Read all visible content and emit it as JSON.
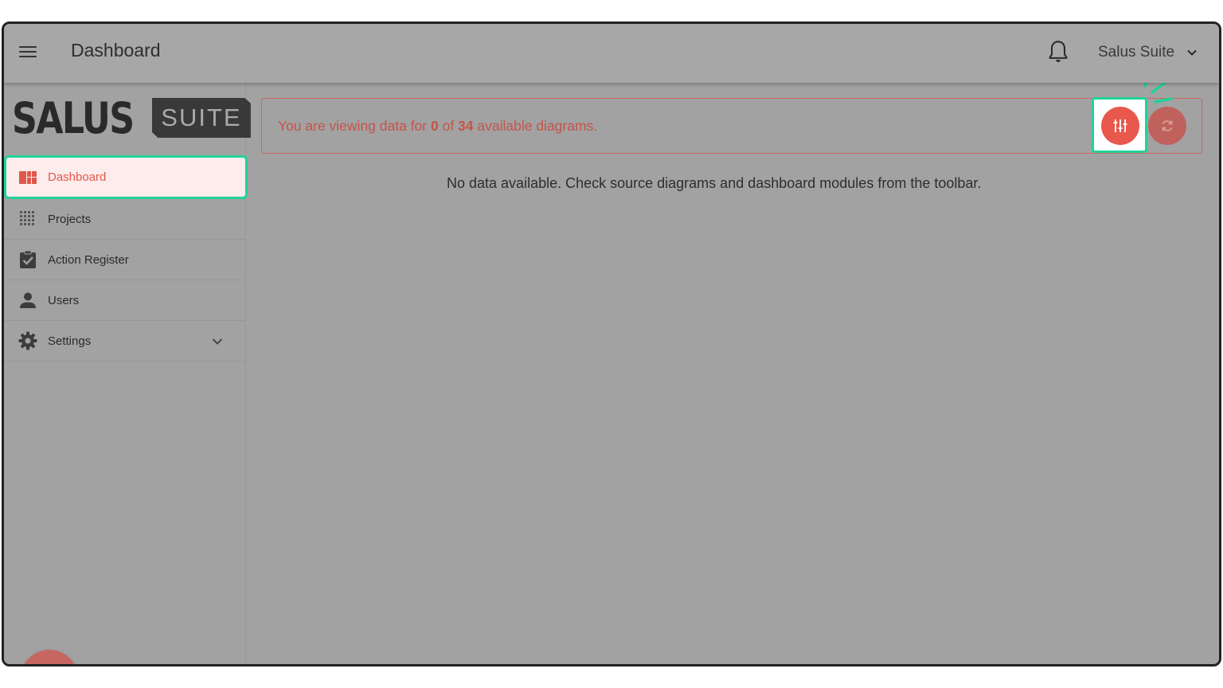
{
  "header": {
    "title": "Dashboard",
    "user_name": "Salus Suite"
  },
  "logo": {
    "primary": "SALUS",
    "secondary": "SUITE"
  },
  "sidebar": {
    "items": [
      {
        "label": "Dashboard",
        "icon": "dashboard-icon",
        "active": true
      },
      {
        "label": "Projects",
        "icon": "grid-dots-icon"
      },
      {
        "label": "Action Register",
        "icon": "clipboard-check-icon"
      },
      {
        "label": "Users",
        "icon": "person-icon"
      },
      {
        "label": "Settings",
        "icon": "gear-icon",
        "expandable": true
      }
    ]
  },
  "banner": {
    "prefix": "You are viewing data for ",
    "viewing_count": "0",
    "middle": " of ",
    "total_count": "34",
    "suffix": " available diagrams."
  },
  "empty_message": "No data available. Check source diagrams and dashboard modules from the toolbar.",
  "colors": {
    "accent": "#e8584c",
    "highlight": "#20d39a",
    "overlay": "#a2a2a2"
  }
}
